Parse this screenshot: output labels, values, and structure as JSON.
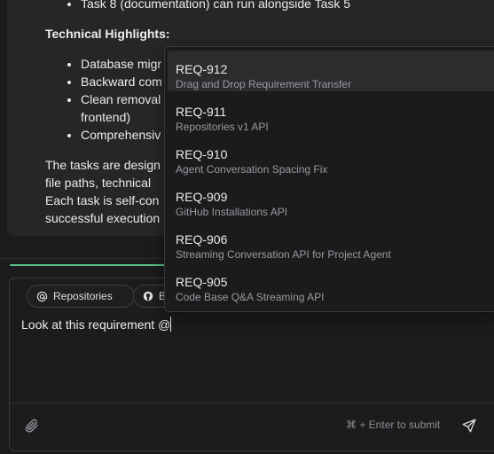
{
  "message": {
    "top_bullet": "Task 8 (documentation) can run alongside Task 5",
    "highlights_heading": "Technical Highlights:",
    "highlights": [
      "Database migr",
      "Backward com",
      "Clean removal",
      "frontend)",
      "Comprehensiv"
    ],
    "paragraph_lines": [
      "The tasks are design",
      "file paths, technical",
      "Each task is self-con",
      "successful execution"
    ]
  },
  "composer": {
    "chips": [
      {
        "label": "Repositories",
        "icon": "at-icon"
      },
      {
        "label": "B",
        "icon": "github-icon"
      }
    ],
    "input_value": "Look at this requirement @",
    "hint": "⌘ + Enter to submit",
    "attach_icon": "paperclip-icon",
    "send_icon": "send-icon"
  },
  "dropdown": {
    "items": [
      {
        "id": "REQ-912",
        "title": "Drag and Drop Requirement Transfer",
        "selected": true
      },
      {
        "id": "REQ-911",
        "title": "Repositories v1 API",
        "selected": false
      },
      {
        "id": "REQ-910",
        "title": "Agent Conversation Spacing Fix",
        "selected": false
      },
      {
        "id": "REQ-909",
        "title": "GitHub Installations API",
        "selected": false
      },
      {
        "id": "REQ-906",
        "title": "Streaming Conversation API for Project Agent",
        "selected": false
      },
      {
        "id": "REQ-905",
        "title": "Code Base Q&A Streaming API",
        "selected": false
      }
    ]
  },
  "colors": {
    "background": "#1c1c1e",
    "card": "#262628",
    "accent_green": "#5ec48a",
    "selected_row": "#2c2c2f"
  }
}
